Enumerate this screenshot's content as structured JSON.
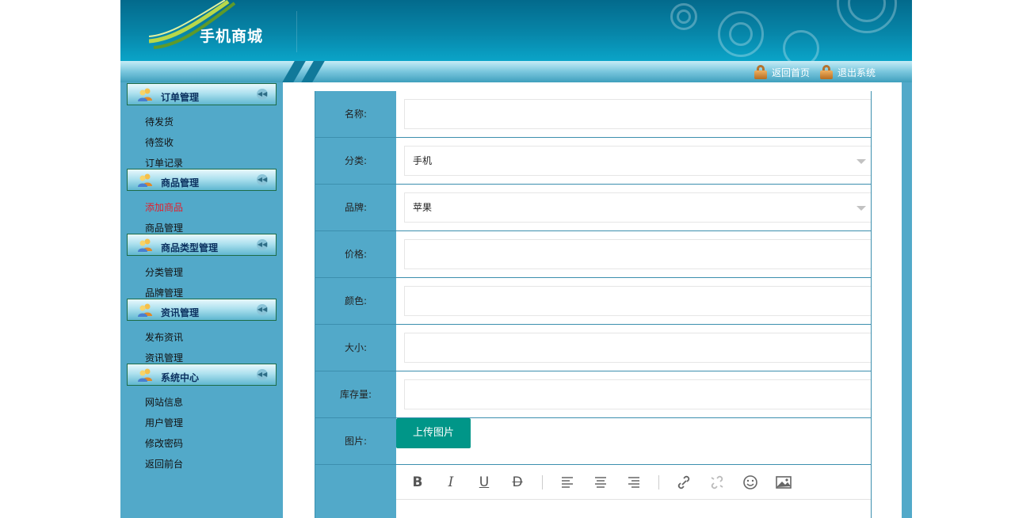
{
  "header": {
    "site_name": "手机商城"
  },
  "topnav": {
    "home_label": "返回首页",
    "logout_label": "退出系统"
  },
  "sidebar": {
    "groups": [
      {
        "title": "订单管理",
        "items": [
          "待发货",
          "待签收",
          "订单记录"
        ]
      },
      {
        "title": "商品管理",
        "items": [
          "添加商品",
          "商品管理"
        ]
      },
      {
        "title": "商品类型管理",
        "items": [
          "分类管理",
          "品牌管理"
        ]
      },
      {
        "title": "资讯管理",
        "items": [
          "发布资讯",
          "资讯管理"
        ]
      },
      {
        "title": "系统中心",
        "items": [
          "网站信息",
          "用户管理",
          "修改密码",
          "返回前台"
        ]
      }
    ],
    "active_item": "添加商品"
  },
  "form": {
    "name_label": "名称:",
    "name_value": "",
    "category_label": "分类:",
    "category_value": "手机",
    "brand_label": "品牌:",
    "brand_value": "苹果",
    "price_label": "价格:",
    "price_value": "",
    "color_label": "颜色:",
    "color_value": "",
    "size_label": "大小:",
    "size_value": "",
    "stock_label": "库存量:",
    "stock_value": "",
    "image_label": "图片:",
    "upload_label": "上传图片"
  },
  "editor": {
    "tools": [
      "bold-icon",
      "italic-icon",
      "underline-icon",
      "strikethrough-icon",
      "align-left-icon",
      "align-center-icon",
      "align-right-icon",
      "link-icon",
      "unlink-icon",
      "emoji-icon",
      "image-icon"
    ]
  },
  "colors": {
    "accent": "#009688",
    "sidebar": "#52a9c9",
    "header": "#0786a9",
    "active_link": "#e3202d"
  }
}
